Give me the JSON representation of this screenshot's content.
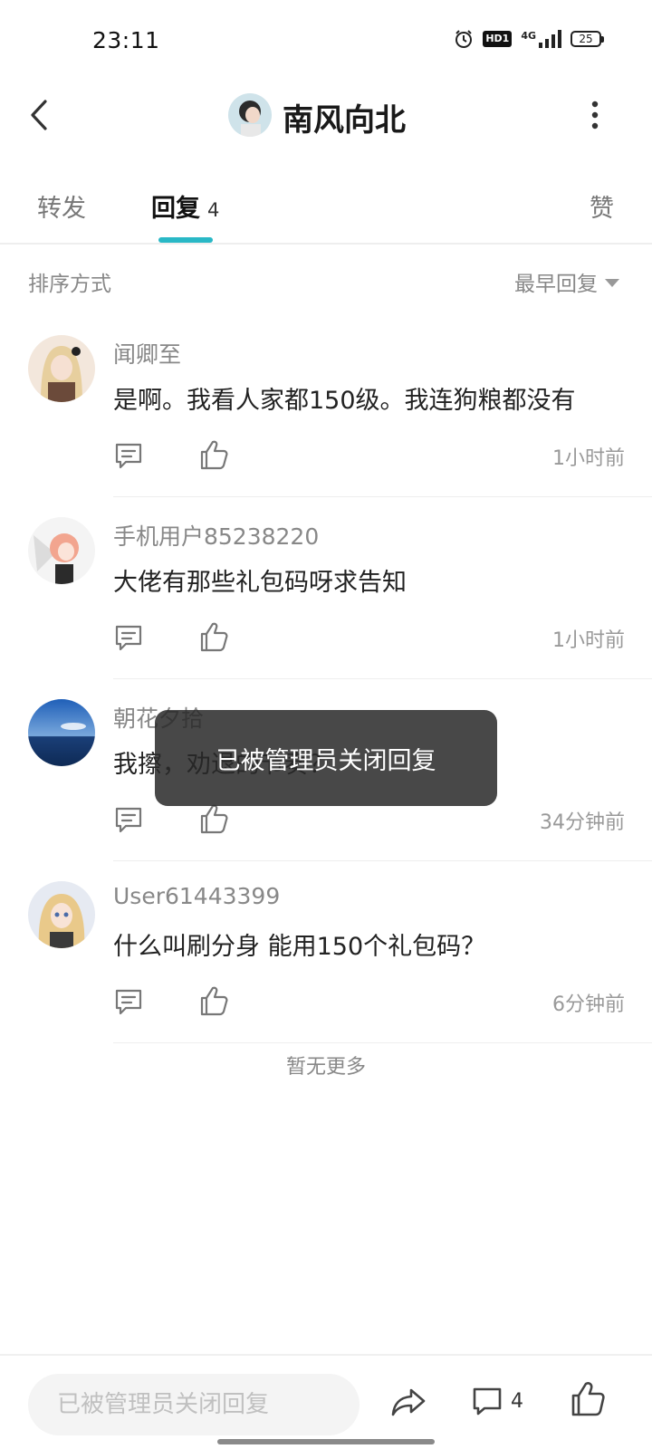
{
  "status_bar": {
    "time": "23:11",
    "network": "4G",
    "hd_label": "HD1",
    "battery": "25"
  },
  "header": {
    "title": "南风向北",
    "back_icon": "chevron-left-icon",
    "more_icon": "more-vertical-icon"
  },
  "tabs": {
    "repost": "转发",
    "reply": "回复",
    "reply_count": "4",
    "like": "赞",
    "active": "reply",
    "accent": "#29b8c6"
  },
  "sort": {
    "label": "排序方式",
    "value": "最早回复"
  },
  "comments": [
    {
      "name": "闻卿至",
      "text": "是啊。我看人家都150级。我连狗粮都没有",
      "time": "1小时前"
    },
    {
      "name": "手机用户85238220",
      "text": "大佬有那些礼包码呀求告知",
      "time": "1小时前"
    },
    {
      "name": "朝花夕拾",
      "text": "我擦，劝退的节奏？",
      "time": "34分钟前"
    },
    {
      "name": "User61443399",
      "text": "什么叫刷分身 能用150个礼包码？",
      "time": "6分钟前"
    }
  ],
  "list_footer": "暂无更多",
  "toast": "已被管理员关闭回复",
  "bottom_bar": {
    "input_placeholder": "已被管理员关闭回复",
    "comment_count": "4"
  }
}
